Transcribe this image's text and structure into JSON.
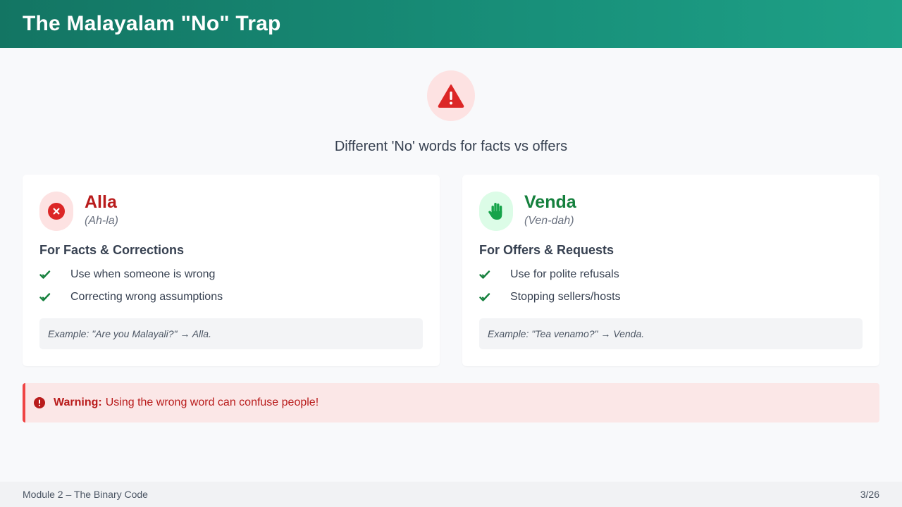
{
  "header": {
    "title": "The Malayalam \"No\" Trap"
  },
  "hero": {
    "icon": "warning-triangle-icon",
    "subtitle": "Different 'No' words for facts vs offers"
  },
  "cards": [
    {
      "icon": "x-circle-icon",
      "word": "Alla",
      "pronunciation": "(Ah-la)",
      "heading": "For Facts & Corrections",
      "bullets": [
        "Use when someone is wrong",
        "Correcting wrong assumptions"
      ],
      "example": "Example: \"Are you Malayali?\" → Alla.",
      "accent": "#b91c1c"
    },
    {
      "icon": "hand-stop-icon",
      "word": "Venda",
      "pronunciation": "(Ven-dah)",
      "heading": "For Offers & Requests",
      "bullets": [
        "Use for polite refusals",
        "Stopping sellers/hosts"
      ],
      "example": "Example: \"Tea venamo?\" → Venda.",
      "accent": "#15803d"
    }
  ],
  "warning": {
    "label": "Warning:",
    "text": "Using the wrong word can confuse people!",
    "icon": "exclamation-circle-icon"
  },
  "footer": {
    "module": "Module 2 – The Binary Code",
    "page": "3/26"
  },
  "colors": {
    "header_start": "#137563",
    "header_end": "#1ea187",
    "danger": "#dc2626",
    "success": "#16a34a"
  }
}
